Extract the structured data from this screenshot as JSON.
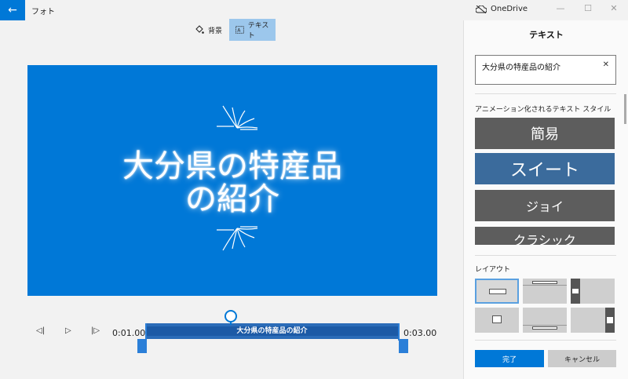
{
  "window": {
    "app_title": "フォト",
    "onedrive_label": "OneDrive",
    "back_glyph": "←",
    "minimize_glyph": "—",
    "maximize_glyph": "☐",
    "close_glyph": "✕"
  },
  "toolbar": {
    "background_label": "背景",
    "text_label": "テキスト",
    "background_icon": "paint-bucket-icon",
    "text_icon": "text-box-icon"
  },
  "canvas": {
    "title_line1": "大分県の特産品",
    "title_line2": "の紹介",
    "background_color": "#0078d7"
  },
  "playback": {
    "prev_glyph": "◁|",
    "play_glyph": "▷",
    "next_glyph": "|▷",
    "start_time": "0:01.00",
    "end_time": "0:03.00",
    "track_label": "大分県の特産品の紹介"
  },
  "panel": {
    "title": "テキスト",
    "text_value": "大分県の特産品の紹介",
    "clear_glyph": "✕",
    "animated_styles_label": "アニメーション化されるテキスト スタイル",
    "styles": [
      "簡易",
      "スイート",
      "ジョイ",
      "クラシック"
    ],
    "selected_style": "スイート",
    "layout_label": "レイアウト",
    "done_label": "完了",
    "cancel_label": "キャンセル",
    "accent_color": "#0078d7"
  }
}
